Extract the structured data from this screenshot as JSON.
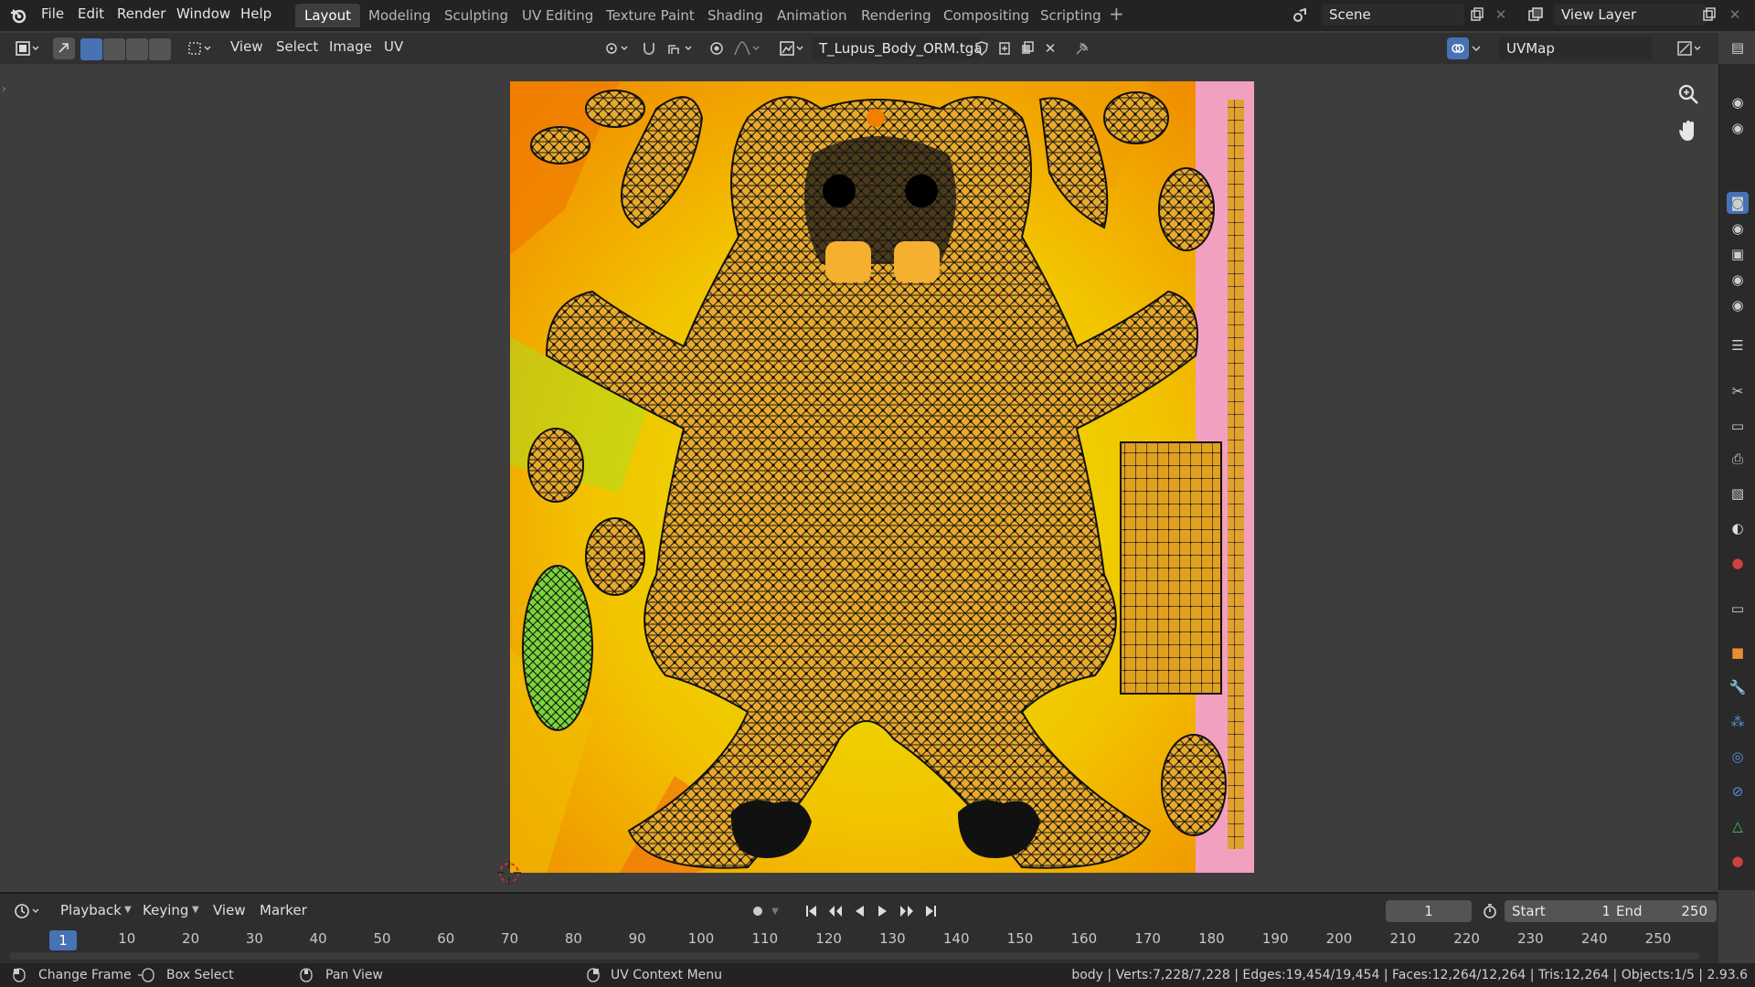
{
  "topbar": {
    "menus": [
      "File",
      "Edit",
      "Render",
      "Window",
      "Help"
    ],
    "workspaces": [
      "Layout",
      "Modeling",
      "Sculpting",
      "UV Editing",
      "Texture Paint",
      "Shading",
      "Animation",
      "Rendering",
      "Compositing",
      "Scripting"
    ],
    "active_workspace": "Layout",
    "add_workspace": "+",
    "scene": "Scene",
    "view_layer": "View Layer"
  },
  "editor": {
    "menus": [
      "View",
      "Select",
      "Image",
      "UV"
    ],
    "image_name": "T_Lupus_Body_ORM.tga",
    "uvmap": "UVMap"
  },
  "timeline": {
    "menus": [
      "Playback",
      "Keying",
      "View",
      "Marker"
    ],
    "current_frame": "1",
    "start_label": "Start",
    "start": "1",
    "end_label": "End",
    "end": "250",
    "ticks": [
      "10",
      "20",
      "30",
      "40",
      "50",
      "60",
      "70",
      "80",
      "90",
      "100",
      "110",
      "120",
      "130",
      "140",
      "150",
      "160",
      "170",
      "180",
      "190",
      "200",
      "210",
      "220",
      "230",
      "240",
      "250"
    ],
    "current_marker": "1"
  },
  "status": {
    "change_frame": "Change Frame",
    "box_select": "Box Select",
    "pan_view": "Pan View",
    "uv_context": "UV Context Menu",
    "stats": "body | Verts:7,228/7,228 | Edges:19,454/19,454 | Faces:12,264/12,264 | Tris:12,264 | Objects:1/5 | 2.93.6"
  },
  "icons": {
    "blender": "blender-logo-icon",
    "zoom": "zoom-icon",
    "hand": "pan-hand-icon",
    "play": "play-icon"
  }
}
